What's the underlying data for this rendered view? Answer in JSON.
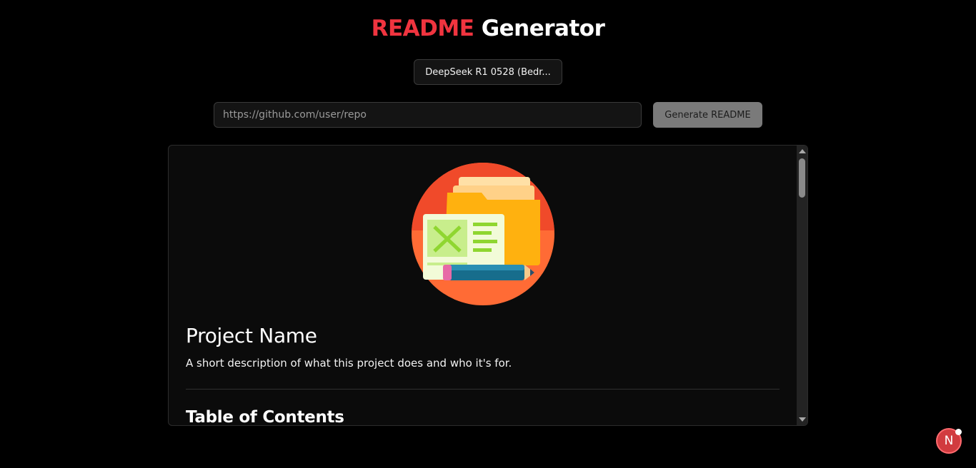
{
  "header": {
    "title_accent": "README",
    "title_rest": "Generator"
  },
  "model_selector": {
    "selected": "DeepSeek R1 0528 (Bedr..."
  },
  "repo_input": {
    "placeholder": "https://github.com/user/repo",
    "value": ""
  },
  "generate_button": {
    "label": "Generate README"
  },
  "preview": {
    "logo_icon": "folder-spreadsheet-pencil-icon",
    "project_name": "Project Name",
    "description": "A short description of what this project does and who it's for.",
    "next_heading": "Table of Contents"
  },
  "fab": {
    "label": "N",
    "icon": "nextjs-dev-indicator-icon"
  },
  "colors": {
    "accent": "#f0343f",
    "background": "#000000",
    "panel": "#0b0b0b"
  }
}
